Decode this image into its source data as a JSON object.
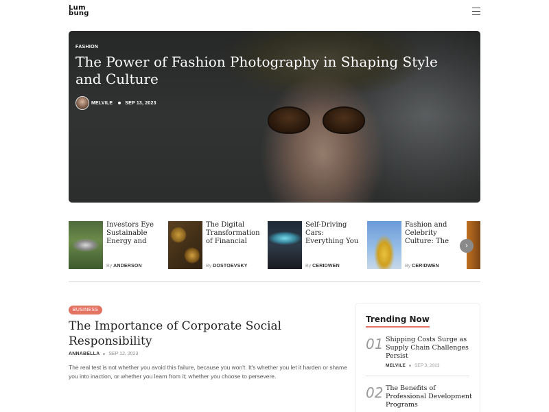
{
  "header": {
    "logo_line1": "Lum",
    "logo_line2": "bung",
    "menu_icon": "hamburger-icon"
  },
  "hero": {
    "category": "FASHION",
    "title": "The Power of Fashion Photography in Shaping Style and Culture",
    "author": "MELVILE",
    "date": "SEP 13, 2023"
  },
  "strip": {
    "by_label": "By",
    "next_icon": "chevron-right-icon",
    "next_glyph": "›",
    "cards": [
      {
        "title": "Investors Eye Sustainable Energy and",
        "author": "ANDERSON"
      },
      {
        "title": "The Digital Transformation of Financial",
        "author": "DOSTOEVSKY"
      },
      {
        "title": "Self-Driving Cars: Everything You Need to Know",
        "author": "CERIDWEN"
      },
      {
        "title": "Fashion and Celebrity Culture: The",
        "author": "CERIDWEN"
      }
    ]
  },
  "article": {
    "badge": "BUSINESS",
    "title": "The Importance of Corporate Social Responsibility",
    "author": "ANNABELLA",
    "date": "SEP 12, 2023",
    "excerpt": "The real test is not whether you avoid this failure, because you won't. It's whether you let it harden or shame you into inaction, or whether you learn from it; whether you choose to persevere."
  },
  "trending": {
    "heading": "Trending Now",
    "items": [
      {
        "num": "01",
        "title": "Shipping Costs Surge as Supply Chain Challenges Persist",
        "author": "MELVILE",
        "date": "SEP 3, 2023"
      },
      {
        "num": "02",
        "title": "The Benefits of Professional Development Programs",
        "author": "",
        "date": ""
      }
    ]
  },
  "colors": {
    "accent": "#e37363"
  }
}
